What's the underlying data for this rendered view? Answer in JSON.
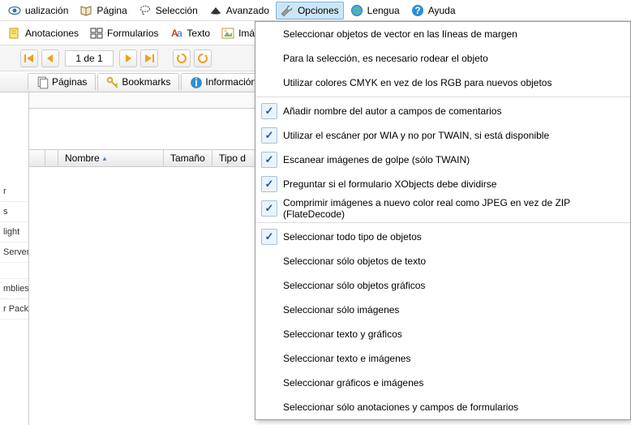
{
  "toolbar1": {
    "visualizacion": "ualización",
    "pagina": "Página",
    "seleccion": "Selección",
    "avanzado": "Avanzado",
    "opciones": "Opciones",
    "lengua": "Lengua",
    "ayuda": "Ayuda"
  },
  "toolbar2": {
    "anotaciones": "Anotaciones",
    "formularios": "Formularios",
    "texto": "Texto",
    "imagenes": "Imág"
  },
  "nav": {
    "page_of": "1 de 1"
  },
  "tabs": {
    "paginas": "Páginas",
    "bookmarks": "Bookmarks",
    "informacion": "Información"
  },
  "left_panel": [
    "r",
    "s",
    "light",
    "Server C",
    "",
    "mblies",
    "r Pack"
  ],
  "grid": {
    "nombre": "Nombre",
    "tamano": "Tamaño",
    "tipo": "Tipo d"
  },
  "menu": {
    "g1": [
      "Seleccionar objetos de vector en las líneas de margen",
      "Para la selección, es necesario rodear el objeto",
      "Utilizar colores CMYK en vez de los RGB para nuevos objetos"
    ],
    "g2": [
      "Añadir nombre del autor a campos de comentarios",
      "Utilizar el escáner por WIA y no por TWAIN, si está disponible",
      "Escanear imágenes de golpe (sólo TWAIN)",
      "Preguntar si el formulario XObjects debe dividirse",
      "Comprimir imágenes a nuevo color real como JPEG en vez de ZIP (FlateDecode)"
    ],
    "g3": [
      "Seleccionar todo tipo de objetos",
      "Seleccionar sólo objetos de texto",
      "Seleccionar sólo objetos gráficos",
      "Seleccionar sólo imágenes",
      "Seleccionar texto y gráficos",
      "Seleccionar texto e imágenes",
      "Seleccionar gráficos e imágenes",
      "Seleccionar sólo anotaciones y campos de formularios"
    ],
    "g2_checked": [
      true,
      true,
      true,
      true,
      true
    ],
    "g3_checked": [
      true,
      false,
      false,
      false,
      false,
      false,
      false,
      false
    ]
  }
}
